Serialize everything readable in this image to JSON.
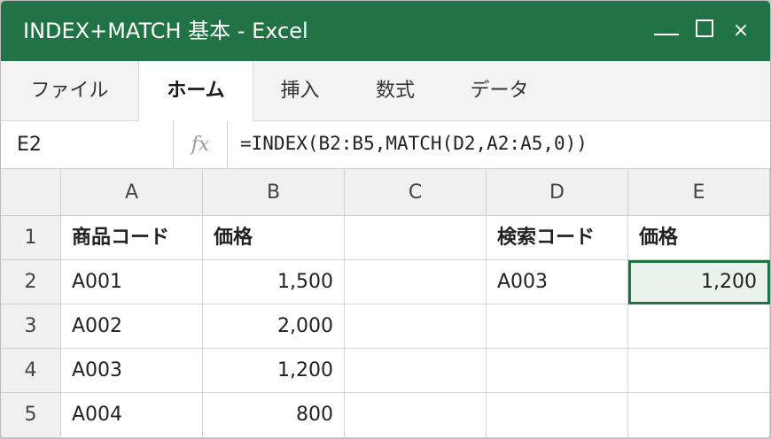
{
  "window": {
    "title": "INDEX+MATCH 基本 - Excel",
    "controls": {
      "minimize_icon": "minimize-icon",
      "maximize_icon": "maximize-icon",
      "close": "×"
    }
  },
  "ribbon": {
    "tabs": [
      {
        "label": "ファイル",
        "active": false
      },
      {
        "label": "ホーム",
        "active": true
      },
      {
        "label": "挿入",
        "active": false
      },
      {
        "label": "数式",
        "active": false
      },
      {
        "label": "データ",
        "active": false
      }
    ]
  },
  "formula_bar": {
    "name_box": "E2",
    "fx_label": "fx",
    "formula": "=INDEX(B2:B5,MATCH(D2,A2:A5,0))"
  },
  "sheet": {
    "columns": [
      "A",
      "B",
      "C",
      "D",
      "E"
    ],
    "rows": [
      {
        "num": "1",
        "A": "商品コード",
        "B": "価格",
        "C": "",
        "D": "検索コード",
        "E": "価格"
      },
      {
        "num": "2",
        "A": "A001",
        "B": "1,500",
        "C": "",
        "D": "A003",
        "E": "1,200"
      },
      {
        "num": "3",
        "A": "A002",
        "B": "2,000",
        "C": "",
        "D": "",
        "E": ""
      },
      {
        "num": "4",
        "A": "A003",
        "B": "1,200",
        "C": "",
        "D": "",
        "E": ""
      },
      {
        "num": "5",
        "A": "A004",
        "B": "800",
        "C": "",
        "D": "",
        "E": ""
      }
    ],
    "selected_cell": "E2",
    "accent_color": "#217346"
  }
}
